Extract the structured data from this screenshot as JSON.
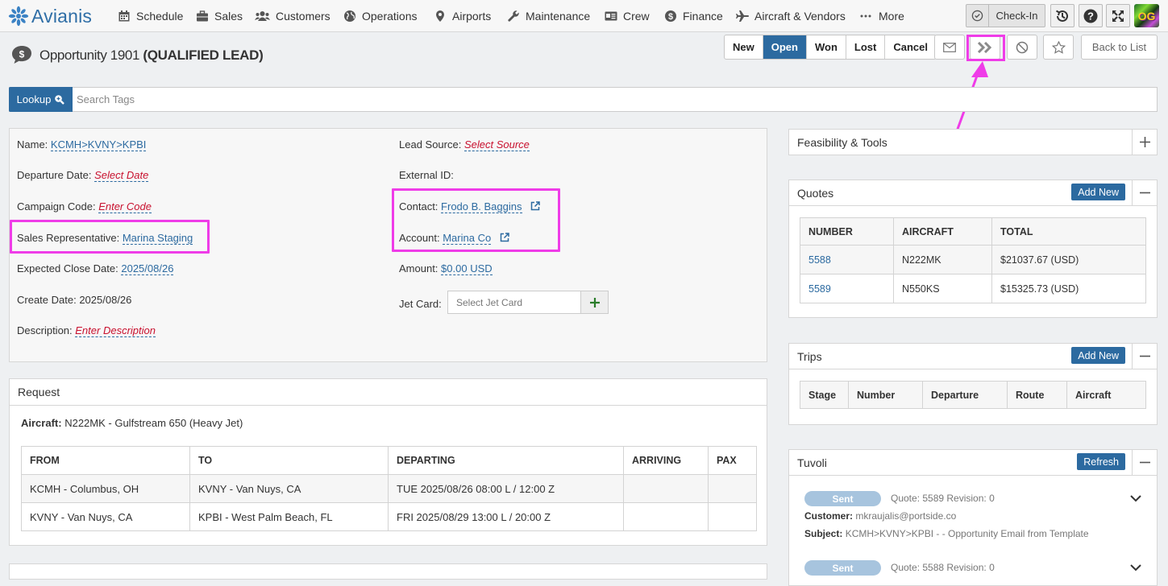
{
  "app": {
    "logo_text": "Avianis"
  },
  "nav": {
    "items": [
      {
        "label": "Schedule",
        "icon": "calendar-icon"
      },
      {
        "label": "Sales",
        "icon": "briefcase-icon"
      },
      {
        "label": "Customers",
        "icon": "users-icon"
      },
      {
        "label": "Operations",
        "icon": "globe-icon"
      },
      {
        "label": "Airports",
        "icon": "map-marker-icon"
      },
      {
        "label": "Maintenance",
        "icon": "wrench-icon"
      },
      {
        "label": "Crew",
        "icon": "id-card-icon"
      },
      {
        "label": "Finance",
        "icon": "dollar-icon"
      },
      {
        "label": "Aircraft & Vendors",
        "icon": "plane-icon"
      },
      {
        "label": "More",
        "icon": "ellipsis-icon"
      }
    ],
    "checkin_label": "Check-In",
    "avatar_text": "OG"
  },
  "page": {
    "title_prefix": "Opportunity 1901",
    "title_status": "(QUALIFIED LEAD)",
    "status_buttons": [
      "New",
      "Open",
      "Won",
      "Lost",
      "Cancel"
    ],
    "active_status": "Open",
    "back_label": "Back to List"
  },
  "lookup": {
    "button_label": "Lookup",
    "placeholder": "Search Tags"
  },
  "details": {
    "name_label": "Name:",
    "name_value": "KCMH>KVNY>KPBI",
    "departure_label": "Departure Date:",
    "departure_value": "Select Date",
    "campaign_label": "Campaign Code:",
    "campaign_value": "Enter Code",
    "salesrep_label": "Sales Representative:",
    "salesrep_value": "Marina Staging",
    "close_label": "Expected Close Date:",
    "close_value": "2025/08/26",
    "create_label": "Create Date:",
    "create_value": "2025/08/26",
    "desc_label": "Description:",
    "desc_value": "Enter Description",
    "lead_label": "Lead Source:",
    "lead_value": "Select Source",
    "external_label": "External ID:",
    "contact_label": "Contact:",
    "contact_value": "Frodo B. Baggins",
    "account_label": "Account:",
    "account_value": "Marina Co",
    "amount_label": "Amount:",
    "amount_value": "$0.00 USD",
    "jetcard_label": "Jet Card:",
    "jetcard_placeholder": "Select Jet Card"
  },
  "request": {
    "title": "Request",
    "aircraft_label": "Aircraft:",
    "aircraft_value": "N222MK - Gulfstream 650 (Heavy Jet)",
    "columns": [
      "FROM",
      "TO",
      "DEPARTING",
      "ARRIVING",
      "PAX"
    ],
    "rows": [
      [
        "KCMH - Columbus, OH",
        "KVNY - Van Nuys, CA",
        "TUE 2025/08/26 08:00 L / 12:00 Z",
        "",
        ""
      ],
      [
        "KVNY - Van Nuys, CA",
        "KPBI - West Palm Beach, FL",
        "FRI 2025/08/29 13:00 L / 20:00 Z",
        "",
        ""
      ]
    ]
  },
  "feasibility": {
    "title": "Feasibility & Tools"
  },
  "quotes": {
    "title": "Quotes",
    "add_label": "Add New",
    "columns": [
      "NUMBER",
      "AIRCRAFT",
      "TOTAL"
    ],
    "rows": [
      [
        "5588",
        "N222MK",
        "$21037.67 (USD)"
      ],
      [
        "5589",
        "N550KS",
        "$15325.73 (USD)"
      ]
    ]
  },
  "trips": {
    "title": "Trips",
    "add_label": "Add New",
    "columns": [
      "Stage",
      "Number",
      "Departure",
      "Route",
      "Aircraft"
    ]
  },
  "tuvoli": {
    "title": "Tuvoli",
    "refresh_label": "Refresh",
    "items": [
      {
        "badge": "Sent",
        "quote": "Quote: 5589 Revision: 0",
        "customer_label": "Customer:",
        "customer": "mkraujalis@portside.co",
        "subject_label": "Subject:",
        "subject": "KCMH>KVNY>KPBI - - Opportunity Email from Template"
      },
      {
        "badge": "Sent",
        "quote": "Quote: 5588 Revision: 0"
      }
    ]
  },
  "colors": {
    "primary": "#2c6aa0",
    "highlight": "#ef3ce8",
    "empty_value": "#c8102e"
  }
}
